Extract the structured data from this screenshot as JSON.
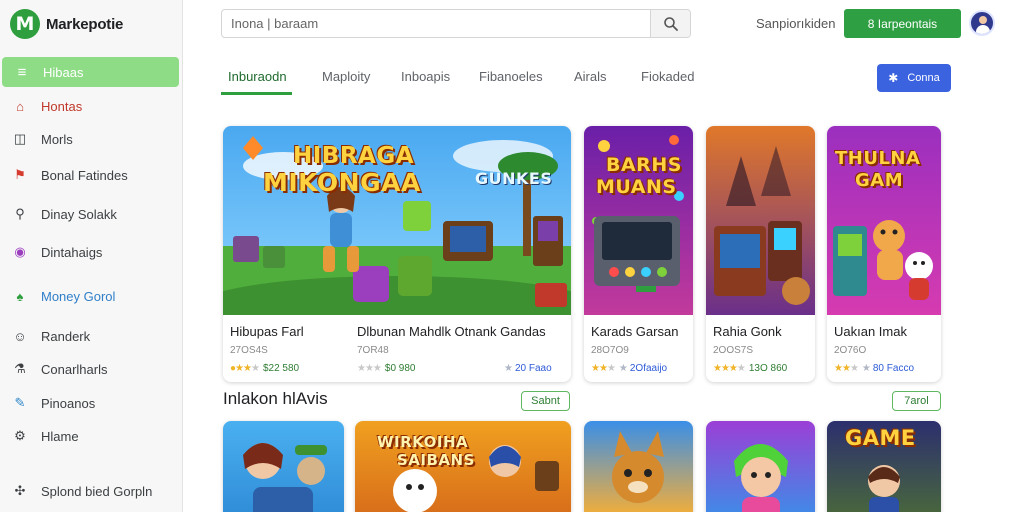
{
  "brand": {
    "name": "Markepotie",
    "mark": "M"
  },
  "sidebar": {
    "items": [
      {
        "label": "Hibaas",
        "icon": "≡",
        "color": "#ffffff"
      },
      {
        "label": "Hontas",
        "icon": "⌂",
        "color": "#c0392b"
      },
      {
        "label": "Morls",
        "icon": "◫",
        "color": "#444444"
      },
      {
        "label": "Bonal Fatindes",
        "icon": "⚑",
        "color": "#d63b2f"
      },
      {
        "label": "Dinay Solakk",
        "icon": "⚲",
        "color": "#444444"
      },
      {
        "label": "Dintahaigs",
        "icon": "◉",
        "color": "#9b3fbf"
      },
      {
        "label": "Money Gorol",
        "icon": "♠",
        "color": "#2e9e3e"
      },
      {
        "label": "Randerk",
        "icon": "☺",
        "color": "#444444"
      },
      {
        "label": "Conarlharls",
        "icon": "⚗",
        "color": "#444444"
      },
      {
        "label": "Pinoanos",
        "icon": "✎",
        "color": "#2f88c9"
      },
      {
        "label": "Hlame",
        "icon": "⚙",
        "color": "#444444"
      },
      {
        "label": "Splond bied Gorpln",
        "icon": "✣",
        "color": "#444444"
      }
    ]
  },
  "header": {
    "search_placeholder": "Inona | baraam",
    "signin_label": "Sanpiorıkiden",
    "cta_label": "8 Iarpeontais",
    "cta_icon": "8"
  },
  "tabs": [
    {
      "label": "Inburaodn"
    },
    {
      "label": "Maploity"
    },
    {
      "label": "Inboapis"
    },
    {
      "label": "Fibanoeles"
    },
    {
      "label": "Airals"
    },
    {
      "label": "Fiokaded"
    }
  ],
  "filter_label": "Conna",
  "featured": [
    {
      "title": "Hibupas Farl",
      "sub": "27OS4S",
      "price": "$22 580",
      "price_prefix": "",
      "art_text": "HIBRAGA\nMIKONGAA",
      "art_text2": "GUNKES"
    },
    {
      "title": "Dlbunan Mahdlk Otnank Gandas",
      "sub": "7OR48",
      "price": "$0 980",
      "price_prefix": "★",
      "art_text": ""
    },
    {
      "title": "Karads Garsan",
      "sub": "28O7O9",
      "price": "20 Faao",
      "price_prefix": "★",
      "art_text": "BARHS\nMUANS"
    },
    {
      "title": "Rahia Gonk",
      "sub": "2OOS7S",
      "price": "13O 860",
      "price_prefix": "★",
      "art_text": ""
    },
    {
      "title": "Uakıan Imak",
      "sub": "2O76O",
      "price": "80 Facco",
      "price_prefix": "★",
      "art_text": "THULNA\nGAM"
    }
  ],
  "section": {
    "title": "Inlakon hlAvis",
    "pill_1": "Sabnt",
    "pill_2": "7arol"
  },
  "second_row_art": [
    "",
    "WIRKOIHA\nSAIBANS",
    "",
    "",
    "GAME"
  ],
  "colors": {
    "accent": "#2e9e3e",
    "active_nav": "#8fdc87",
    "filter": "#3b63e0"
  }
}
